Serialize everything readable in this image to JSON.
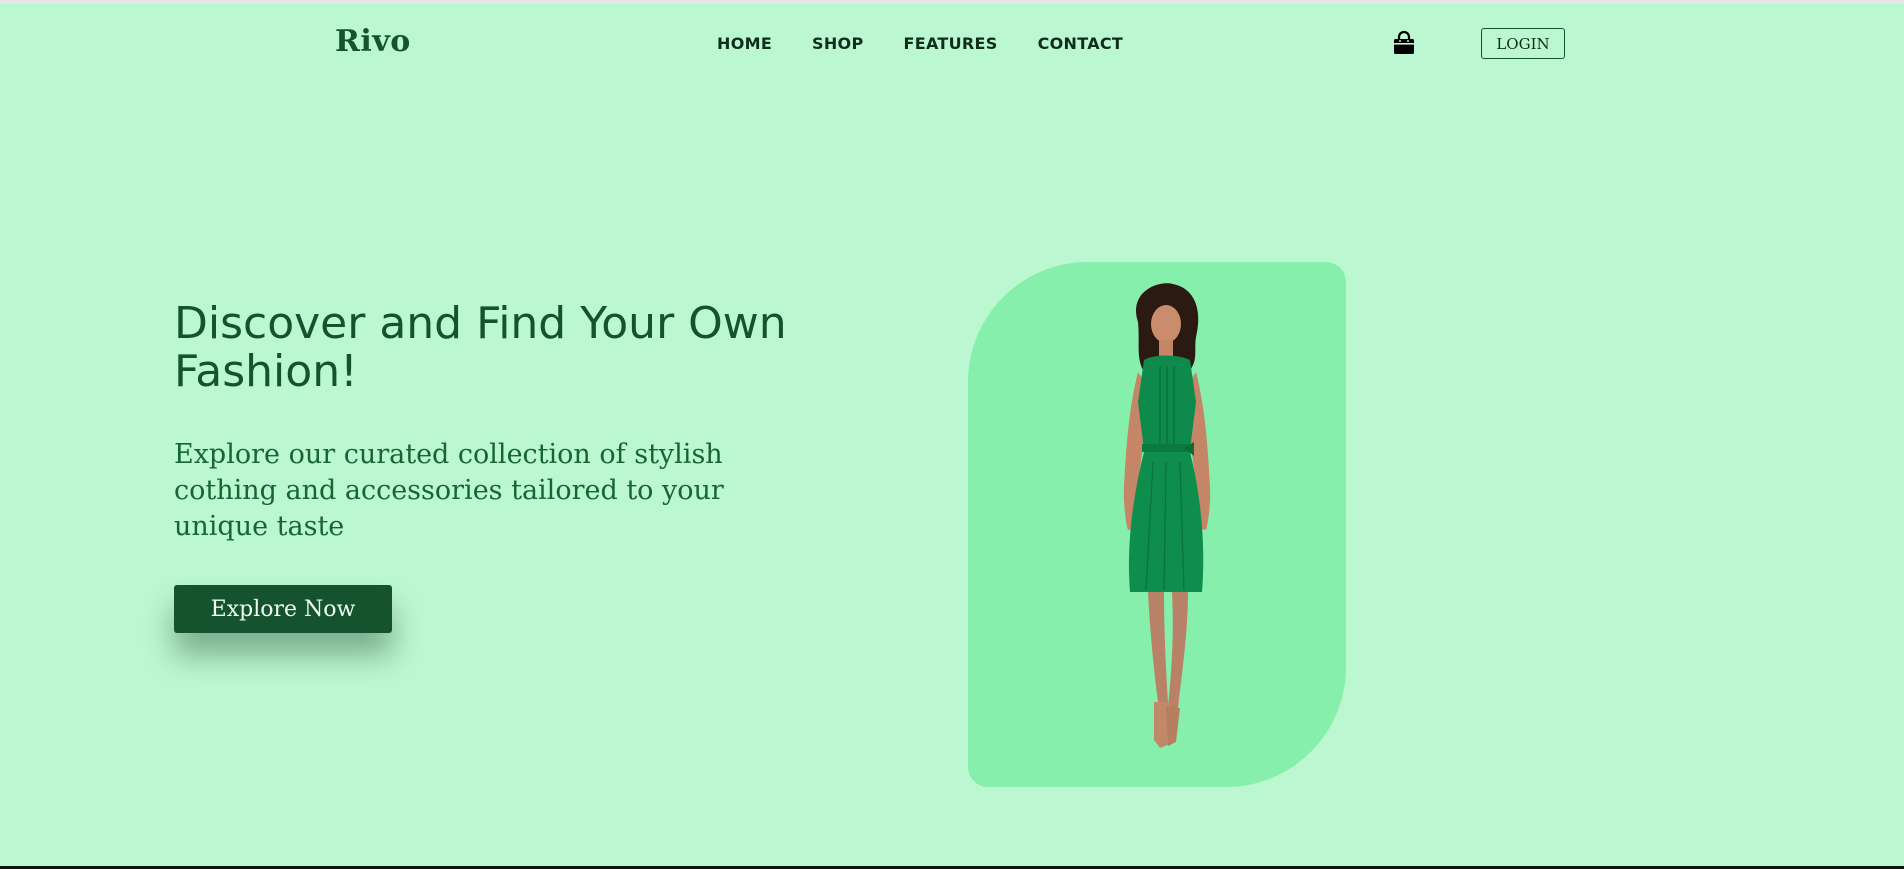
{
  "brand": {
    "name": "Rivo"
  },
  "nav": {
    "items": [
      {
        "label": "HOME"
      },
      {
        "label": "SHOP"
      },
      {
        "label": "FEATURES"
      },
      {
        "label": "CONTACT"
      }
    ]
  },
  "header": {
    "cart_icon": "shopping-bag-icon",
    "login_label": "LOGIN"
  },
  "hero": {
    "title": "Discover and Find Your Own Fashion!",
    "subtitle": "Explore our curated collection of stylish cothing and accessories tailored to your unique taste",
    "cta_label": "Explore Now",
    "image_subject": "woman-in-green-dress"
  },
  "colors": {
    "background": "#bbf7d0",
    "card": "#86efac",
    "accent": "#14532d",
    "text": "#166534"
  }
}
